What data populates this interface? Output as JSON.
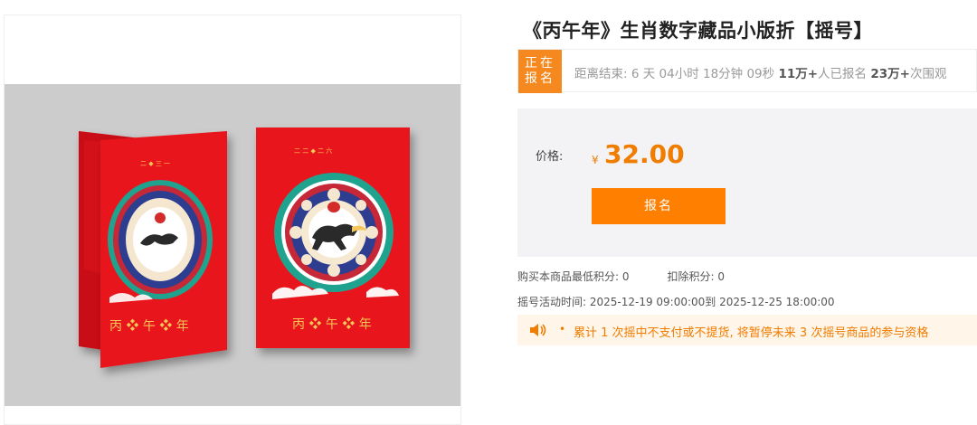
{
  "product": {
    "title": "《丙午年》生肖数字藏品小版折【摇号】",
    "image_card_text": "丙❖午❖年"
  },
  "status": {
    "badge_line1": "正在",
    "badge_line2": "报名",
    "countdown_prefix": "距离结束: 6 天 04小时 18分钟 09秒",
    "signups_count": "11万+",
    "signups_suffix": "人已报名",
    "views_count": "23万+",
    "views_suffix": "次围观"
  },
  "price": {
    "label": "价格:",
    "currency": "¥",
    "value": "32.00",
    "button_label": "报名"
  },
  "meta": {
    "min_points": "购买本商品最低积分:  0",
    "deduct_points": "扣除积分:  0",
    "lottery_time": "摇号活动时间:   2025-12-19 09:00:00到 2025-12-25 18:00:00"
  },
  "notice": {
    "bullet": "•",
    "text": "累计 1 次摇中不支付或不提货,  将暂停未来 3 次摇号商品的参与资格"
  },
  "colors": {
    "accent": "#ff7f00",
    "price": "#f07c00",
    "card_red": "#e8131b",
    "notice_bg": "#fff5e8"
  },
  "icons": {
    "notice": "speaker-icon"
  }
}
